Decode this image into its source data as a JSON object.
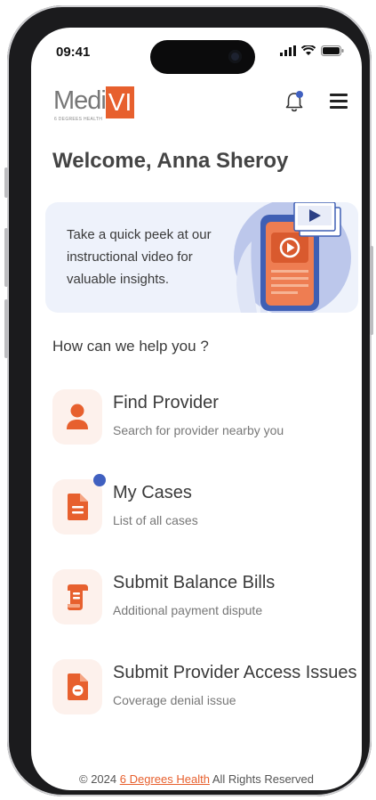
{
  "status_bar": {
    "time": "09:41"
  },
  "header": {
    "logo_main": "Medi",
    "logo_accent": "VI",
    "logo_tagline": "6 DEGREES HEALTH"
  },
  "welcome": {
    "text": "Welcome, Anna Sheroy"
  },
  "banner": {
    "text": "Take a quick peek at our instructional video for valuable insights."
  },
  "help": {
    "heading": "How can we help you ?"
  },
  "menu_items": [
    {
      "title": "Find Provider",
      "subtitle": "Search for provider nearby you",
      "icon": "person-icon"
    },
    {
      "title": "My Cases",
      "subtitle": "List of all cases",
      "icon": "document-icon",
      "has_notification": true
    },
    {
      "title": "Submit Balance Bills",
      "subtitle": "Additional payment dispute",
      "icon": "receipt-icon"
    },
    {
      "title": "Submit Provider Access Issues",
      "subtitle": "Coverage denial issue",
      "icon": "document-block-icon"
    }
  ],
  "footer": {
    "prefix": "© 2024 ",
    "link": "6 Degrees Health",
    "suffix": " All Rights Reserved"
  },
  "colors": {
    "accent": "#e7602e",
    "accent_bg": "#fdf1ec",
    "notification": "#4060c0",
    "banner_bg": "#eef2fb"
  }
}
